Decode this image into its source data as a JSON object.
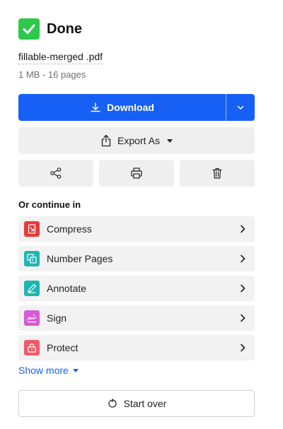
{
  "header": {
    "title": "Done",
    "status_icon": "check-icon",
    "status_color": "#2ec84a"
  },
  "file": {
    "name": "fillable-merged .pdf",
    "meta": "1 MB - 16 pages"
  },
  "actions": {
    "download_label": "Download",
    "download_color": "#1660f6",
    "export_label": "Export As",
    "icon_buttons": [
      "share-icon",
      "print-icon",
      "trash-icon"
    ]
  },
  "continue_in": {
    "label": "Or continue in",
    "tools": [
      {
        "label": "Compress",
        "icon": "compress-icon",
        "color": "#e63a3a"
      },
      {
        "label": "Number Pages",
        "icon": "number-pages-icon",
        "color": "#1fb5b0"
      },
      {
        "label": "Annotate",
        "icon": "annotate-icon",
        "color": "#1fb5b0"
      },
      {
        "label": "Sign",
        "icon": "sign-icon",
        "color": "#d65ad6"
      },
      {
        "label": "Protect",
        "icon": "protect-icon",
        "color": "#ef5a6a"
      }
    ]
  },
  "show_more_label": "Show more",
  "start_over_label": "Start over"
}
